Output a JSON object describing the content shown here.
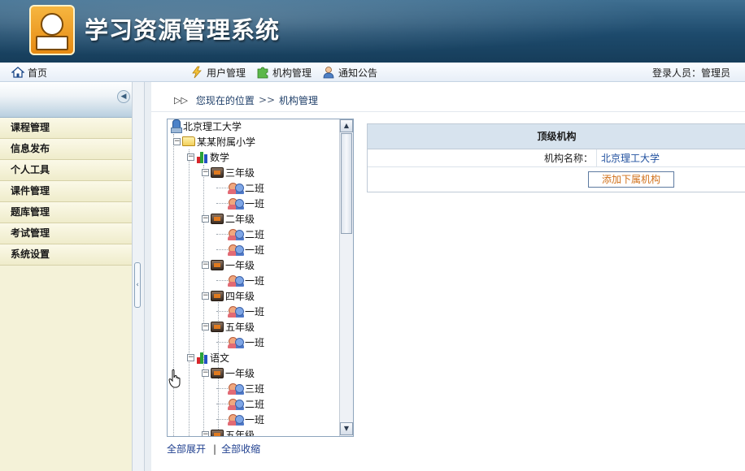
{
  "app": {
    "title": "学习资源管理系统"
  },
  "navbar": {
    "home": "首页",
    "items": [
      "用户管理",
      "机构管理",
      "通知公告"
    ],
    "login_label": "登录人员：",
    "login_user": "管理员"
  },
  "sidebar": {
    "items": [
      "课程管理",
      "信息发布",
      "个人工具",
      "课件管理",
      "题库管理",
      "考试管理",
      "系统设置"
    ]
  },
  "breadcrumb": {
    "prefix": "您现在的位置",
    "separator": ">>",
    "current": "机构管理"
  },
  "tree": {
    "nodes": [
      {
        "label": "北京理工大学",
        "icon": "university-icon",
        "level": 0
      },
      {
        "label": "某某附属小学",
        "icon": "folder-icon",
        "level": 1
      },
      {
        "label": "数学",
        "icon": "subject-chart-icon",
        "level": 2
      },
      {
        "label": "三年级",
        "icon": "grade-icon",
        "level": 3
      },
      {
        "label": "二班",
        "icon": "class-icon",
        "level": 4
      },
      {
        "label": "一班",
        "icon": "class-icon",
        "level": 4
      },
      {
        "label": "二年级",
        "icon": "grade-icon",
        "level": 3
      },
      {
        "label": "二班",
        "icon": "class-icon",
        "level": 4
      },
      {
        "label": "一班",
        "icon": "class-icon",
        "level": 4
      },
      {
        "label": "一年级",
        "icon": "grade-icon",
        "level": 3
      },
      {
        "label": "一班",
        "icon": "class-icon",
        "level": 4
      },
      {
        "label": "四年级",
        "icon": "grade-icon",
        "level": 3
      },
      {
        "label": "一班",
        "icon": "class-icon",
        "level": 4
      },
      {
        "label": "五年级",
        "icon": "grade-icon",
        "level": 3
      },
      {
        "label": "一班",
        "icon": "class-icon",
        "level": 4
      },
      {
        "label": "语文",
        "icon": "subject-chart-icon",
        "level": 2
      },
      {
        "label": "一年级",
        "icon": "grade-icon",
        "level": 3
      },
      {
        "label": "三班",
        "icon": "class-icon",
        "level": 4
      },
      {
        "label": "二班",
        "icon": "class-icon",
        "level": 4
      },
      {
        "label": "一班",
        "icon": "class-icon",
        "level": 4
      },
      {
        "label": "五年级",
        "icon": "grade-icon",
        "level": 3
      }
    ],
    "expand_all": "全部展开",
    "collapse_all": "全部收缩",
    "links_separator": "|"
  },
  "detail": {
    "header": "顶级机构",
    "name_label": "机构名称：",
    "name_value": "北京理工大学",
    "add_button": "添加下属机构"
  },
  "colors": {
    "banner": "#1d4a6c",
    "sidebar_bg": "#f4f2d8",
    "table_header": "#d7e3ee",
    "link": "#1f3f8f",
    "button_text": "#d0701a"
  }
}
